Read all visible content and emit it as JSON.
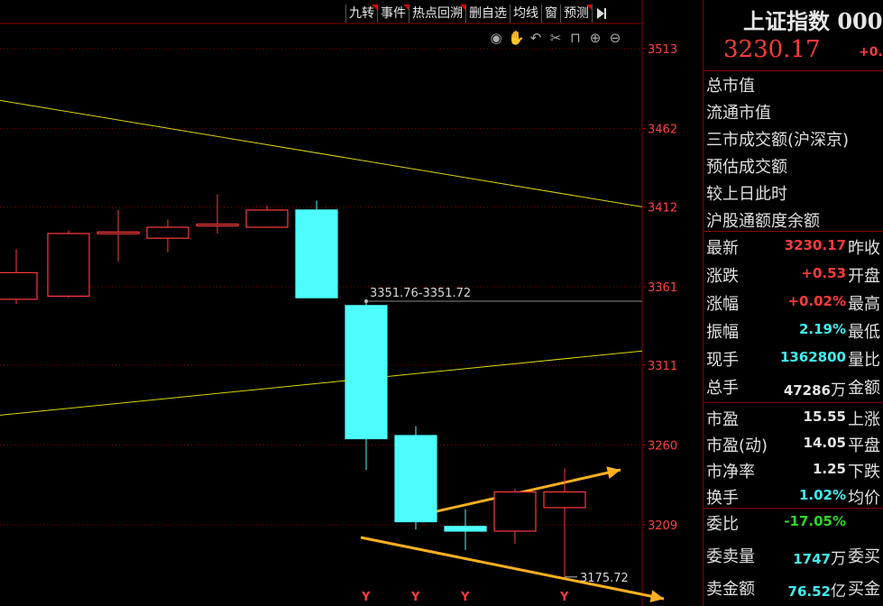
{
  "toolbar": {
    "items": [
      {
        "label": "九转",
        "mark": true
      },
      {
        "label": "事件",
        "mark": true
      },
      {
        "label": "热点回溯",
        "mark": true
      },
      {
        "label": "删自选",
        "mark": false
      },
      {
        "label": "均线",
        "mark": false
      },
      {
        "label": "窗",
        "mark": false
      },
      {
        "label": "预测",
        "mark": true
      }
    ]
  },
  "tools": [
    "eye-icon",
    "hand-icon",
    "undo-icon",
    "scissors-icon",
    "lock-icon",
    "zoom-in-icon",
    "zoom-out-icon"
  ],
  "colors": {
    "up": "#ff3b3b",
    "down": "#4dfdfd",
    "axis": "#8a0000",
    "trend": "#d8d800",
    "arrow": "#ffb020"
  },
  "chart_data": {
    "type": "candlestick",
    "y_ticks": [
      3513,
      3462,
      3412,
      3361,
      3311,
      3260,
      3209
    ],
    "ylim": [
      3150,
      3560
    ],
    "candles": [
      {
        "o": 3353,
        "c": 3370,
        "h": 3385,
        "l": 3350
      },
      {
        "o": 3355,
        "c": 3395,
        "h": 3397,
        "l": 3354
      },
      {
        "o": 3396,
        "c": 3396,
        "h": 3410,
        "l": 3377
      },
      {
        "o": 3392,
        "c": 3399,
        "h": 3404,
        "l": 3383
      },
      {
        "o": 3400,
        "c": 3401,
        "h": 3420,
        "l": 3395
      },
      {
        "o": 3399,
        "c": 3410,
        "h": 3413,
        "l": 3399
      },
      {
        "o": 3410,
        "c": 3354,
        "h": 3416,
        "l": 3354
      },
      {
        "o": 3349,
        "c": 3264,
        "h": 3352,
        "l": 3244
      },
      {
        "o": 3266,
        "c": 3211,
        "h": 3272,
        "l": 3206
      },
      {
        "o": 3208,
        "c": 3205,
        "h": 3219,
        "l": 3193
      },
      {
        "o": 3205,
        "c": 3230,
        "h": 3232,
        "l": 3197
      },
      {
        "o": 3220,
        "c": 3230,
        "h": 3245,
        "l": 3176
      }
    ],
    "y_markers": [
      "",
      "",
      "",
      "",
      "",
      "",
      "",
      "Y",
      "Y",
      "Y",
      "",
      "Y"
    ],
    "annotations": {
      "high_label": "3351.76-3351.72",
      "low_label": "3175.72"
    }
  },
  "stock": {
    "title": "上证指数 000",
    "price": "3230.17",
    "pct_short": "+0."
  },
  "info_labels": [
    "总市值",
    "流通市值",
    "三市成交额(沪深京)",
    "预估成交额",
    "较上日此时",
    "沪股通额度余额"
  ],
  "quote_rows": [
    {
      "k": "最新",
      "v": "3230.17",
      "unit": "",
      "color": "red",
      "k2": "昨收"
    },
    {
      "k": "涨跌",
      "v": "+0.53",
      "unit": "",
      "color": "red",
      "k2": "开盘"
    },
    {
      "k": "涨幅",
      "v": "+0.02%",
      "unit": "",
      "color": "red",
      "k2": "最高"
    },
    {
      "k": "振幅",
      "v": "2.19%",
      "unit": "",
      "color": "cyan",
      "k2": "最低"
    },
    {
      "k": "现手",
      "v": "1362800",
      "unit": "",
      "color": "cyan",
      "k2": "量比"
    },
    {
      "k": "总手",
      "v": "47286",
      "unit": "万",
      "color": "white",
      "k2": "金额"
    }
  ],
  "market_rows": [
    {
      "k": "市盈",
      "v": "15.55",
      "unit": "",
      "color": "white",
      "k2": "上涨"
    },
    {
      "k": "市盈(动)",
      "v": "14.05",
      "unit": "",
      "color": "white",
      "k2": "平盘"
    },
    {
      "k": "市净率",
      "v": "1.25",
      "unit": "",
      "color": "white",
      "k2": "下跌"
    },
    {
      "k": "换手",
      "v": "1.02%",
      "unit": "",
      "color": "cyan",
      "k2": "均价"
    }
  ],
  "order_rows": [
    {
      "k": "委比",
      "v": "-17.05%",
      "unit": "",
      "color": "green",
      "k2": ""
    },
    {
      "k": "委卖量",
      "v": "1747",
      "unit": "万",
      "color": "cyan",
      "k2": "委买"
    },
    {
      "k": "卖金额",
      "v": "76.52",
      "unit": "亿",
      "color": "cyan",
      "k2": "买金"
    }
  ]
}
